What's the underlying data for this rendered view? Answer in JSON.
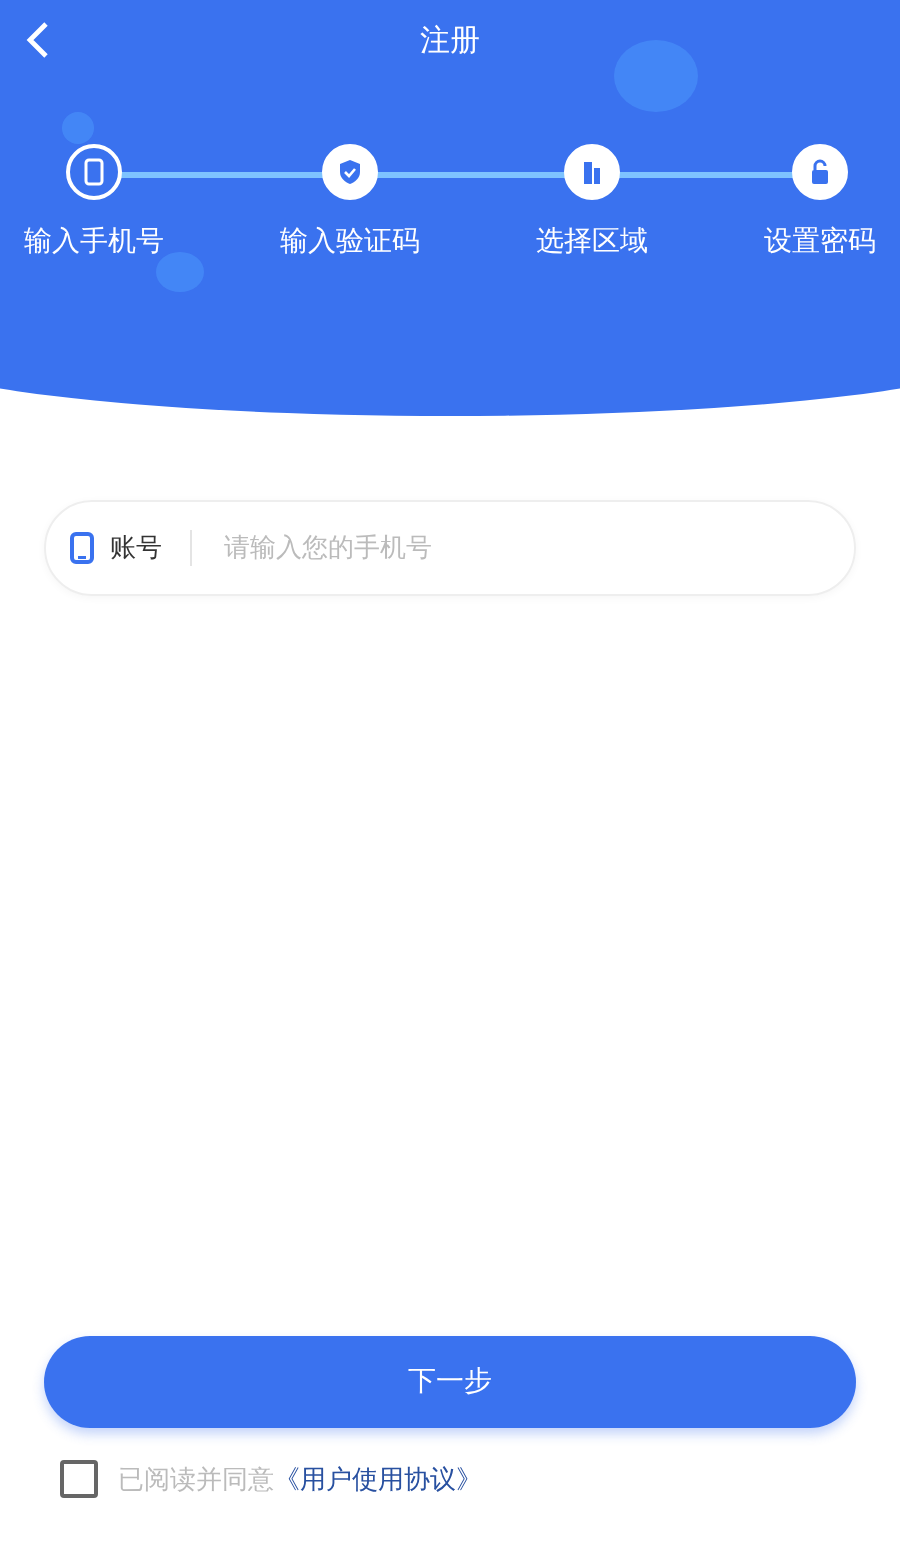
{
  "header": {
    "title": "注册"
  },
  "steps": [
    {
      "label": "输入手机号",
      "kind": "phone",
      "selected": true
    },
    {
      "label": "输入验证码",
      "kind": "shield",
      "selected": false
    },
    {
      "label": "选择区域",
      "kind": "building",
      "selected": false
    },
    {
      "label": "设置密码",
      "kind": "lock",
      "selected": false
    }
  ],
  "account_field": {
    "label": "账号",
    "placeholder": "请输入您的手机号"
  },
  "next_button": "下一步",
  "agreement": {
    "checked": false,
    "text": "已阅读并同意",
    "link": "《用户使用协议》"
  }
}
